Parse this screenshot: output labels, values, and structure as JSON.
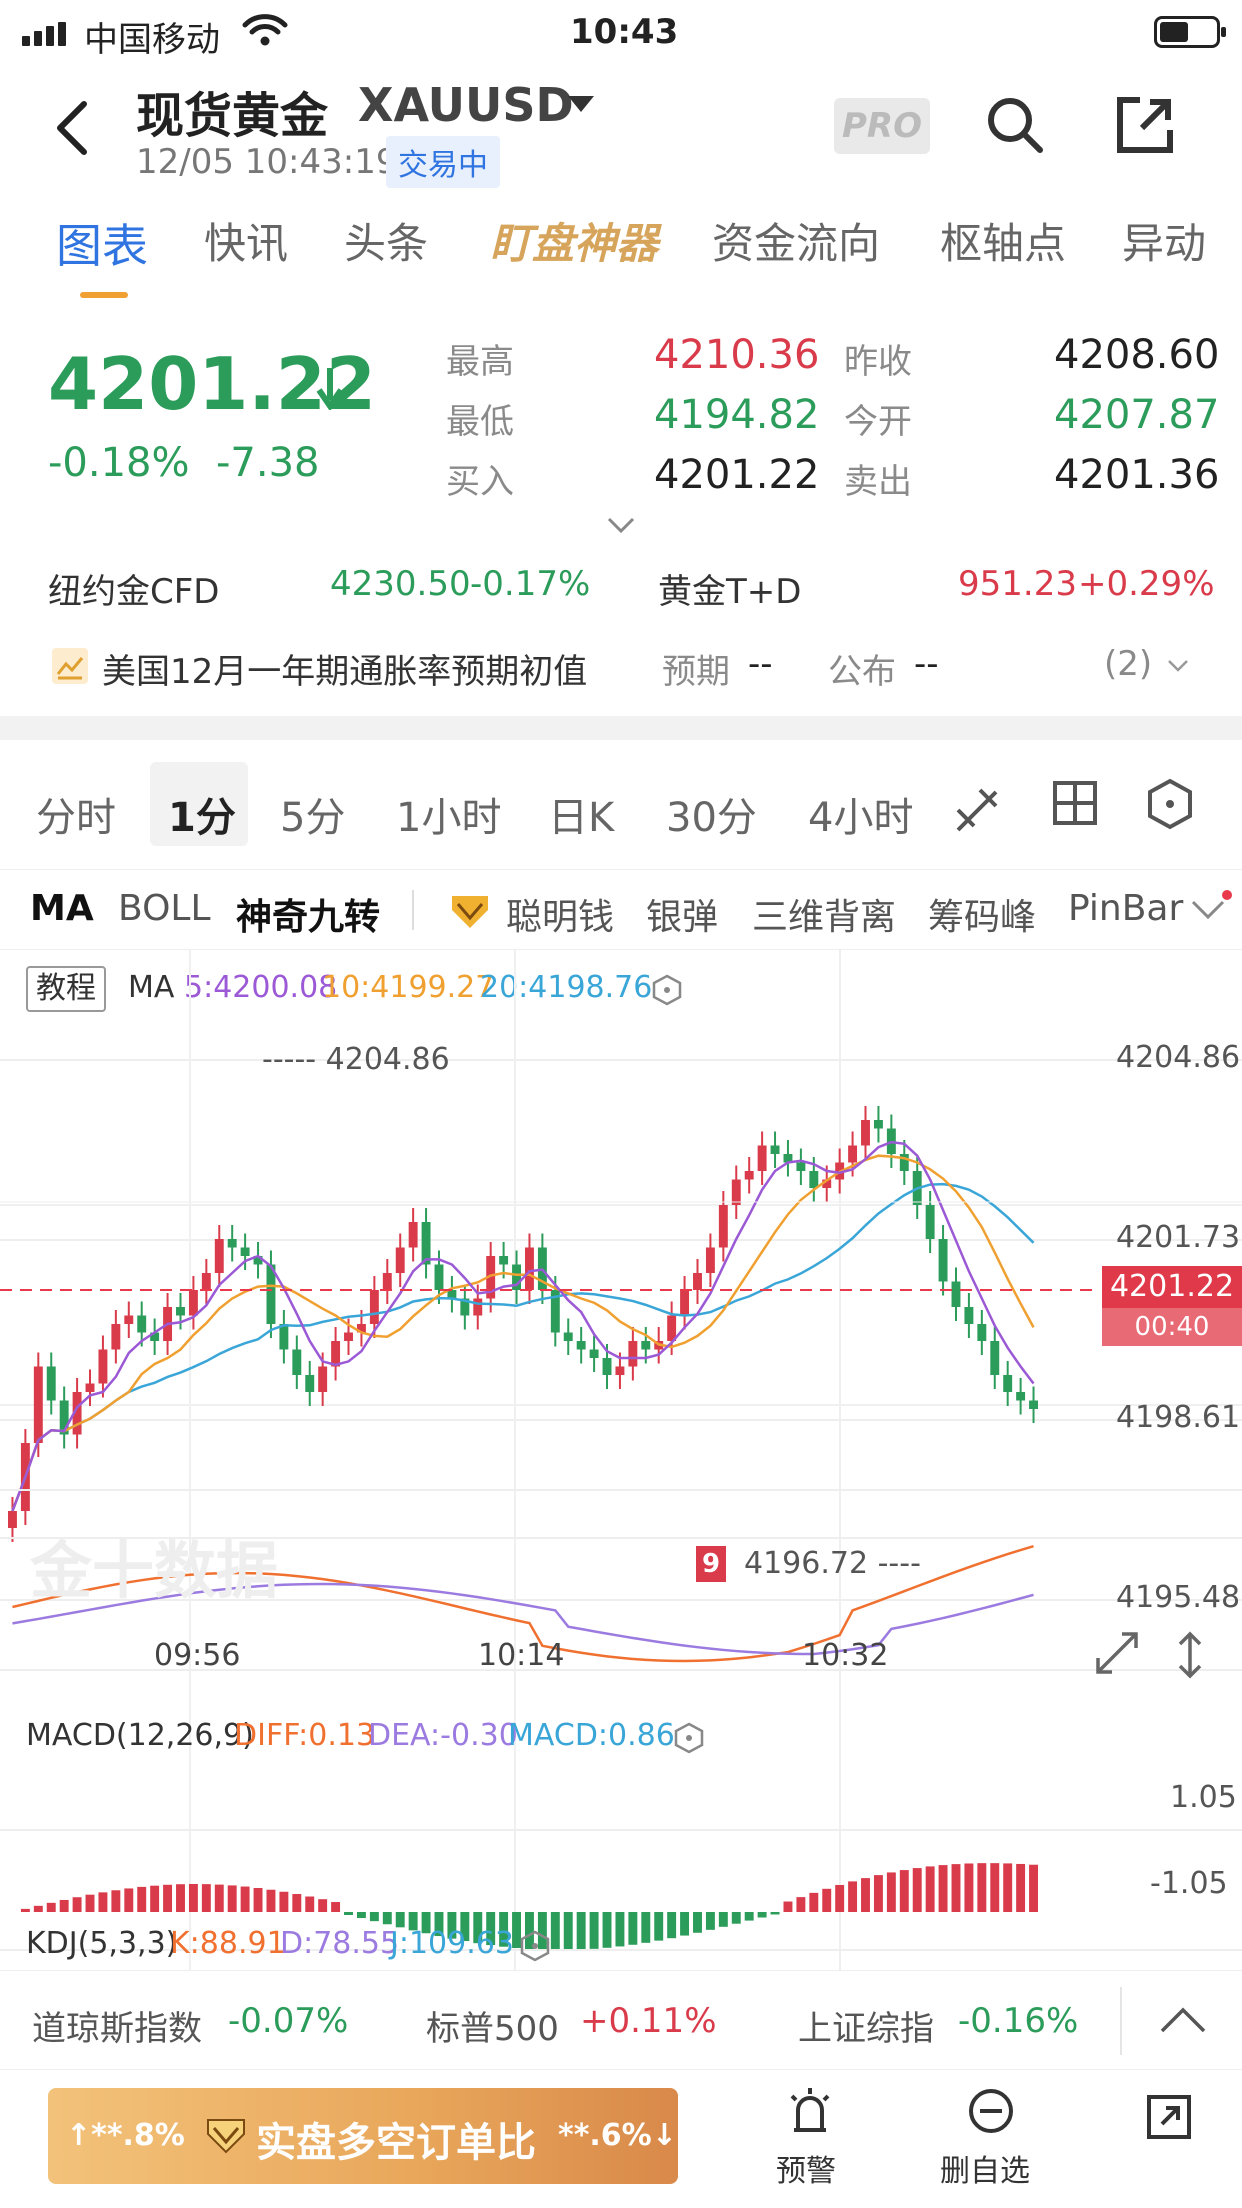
{
  "status": {
    "carrier": "中国移动",
    "time": "10:43"
  },
  "header": {
    "title": "现货黄金",
    "symbol": "XAUUSD",
    "datetime": "12/05 10:43:19",
    "trading_status": "交易中",
    "pro_label": "PRO"
  },
  "tabs": [
    {
      "label": "图表"
    },
    {
      "label": "快讯"
    },
    {
      "label": "头条"
    },
    {
      "label": "盯盘神器"
    },
    {
      "label": "资金流向"
    },
    {
      "label": "枢轴点"
    },
    {
      "label": "异动"
    }
  ],
  "quote": {
    "price": "4201.22",
    "change_pct": "-0.18%",
    "change": "-7.38",
    "high_label": "最高",
    "high": "4210.36",
    "low_label": "最低",
    "low": "4194.82",
    "bid_label": "买入",
    "bid": "4201.22",
    "prev_close_label": "昨收",
    "prev_close": "4208.60",
    "open_label": "今开",
    "open": "4207.87",
    "ask_label": "卖出",
    "ask": "4201.36"
  },
  "related": [
    {
      "name": "纽约金CFD",
      "price": "4230.50",
      "change": "-0.17%"
    },
    {
      "name": "黄金T+D",
      "price": "951.23",
      "change": "+0.29%"
    }
  ],
  "event": {
    "title": "美国12月一年期通胀率预期初值",
    "expected_label": "预期",
    "expected": "--",
    "actual_label": "公布",
    "actual": "--",
    "count": "(2)"
  },
  "periods": [
    "分时",
    "1分",
    "5分",
    "1小时",
    "日K",
    "30分",
    "4小时"
  ],
  "indicators": [
    "MA",
    "BOLL",
    "神奇九转",
    "聪明钱",
    "银弹",
    "三维背离",
    "筹码峰",
    "PinBar"
  ],
  "ma_legend": {
    "tutorial": "教程",
    "label": "MA",
    "ma5": "5:4200.08",
    "ma10": "10:4199.27",
    "ma20": "20:4198.76"
  },
  "price_axis": [
    "4204.86",
    "4201.73",
    "4198.61",
    "4195.48"
  ],
  "current_price_tag": {
    "price": "4201.22",
    "countdown": "00:40"
  },
  "high_marker": "4204.86",
  "low_marker": "4196.72",
  "time_axis": [
    "09:56",
    "10:14",
    "10:32"
  ],
  "watermark": "金十数据",
  "macd": {
    "label": "MACD(12,26,9)",
    "diff": "DIFF:0.13",
    "dea": "DEA:-0.30",
    "macd": "MACD:0.86",
    "axis_top": "1.05",
    "axis_bottom": "-1.05"
  },
  "kdj": {
    "label": "KDJ(5,3,3)",
    "k": "K:88.91",
    "d": "D:78.55",
    "j": "J:109.63"
  },
  "indices": [
    {
      "name": "道琼斯指数",
      "change": "-0.07%"
    },
    {
      "name": "标普500",
      "change": "+0.11%"
    },
    {
      "name": "上证综指",
      "change": "-0.16%"
    }
  ],
  "bottom": {
    "left_pct": "**.8%",
    "center_label": "实盘多空订单比",
    "right_pct": "**.6%",
    "alert_label": "预警",
    "delete_label": "删自选"
  },
  "colors": {
    "up": "#d93b4a",
    "down": "#2c9c5b",
    "accent": "#2f74e0",
    "ma5": "#9b59d6",
    "ma10": "#f0a030",
    "ma20": "#3aa6d8"
  }
}
